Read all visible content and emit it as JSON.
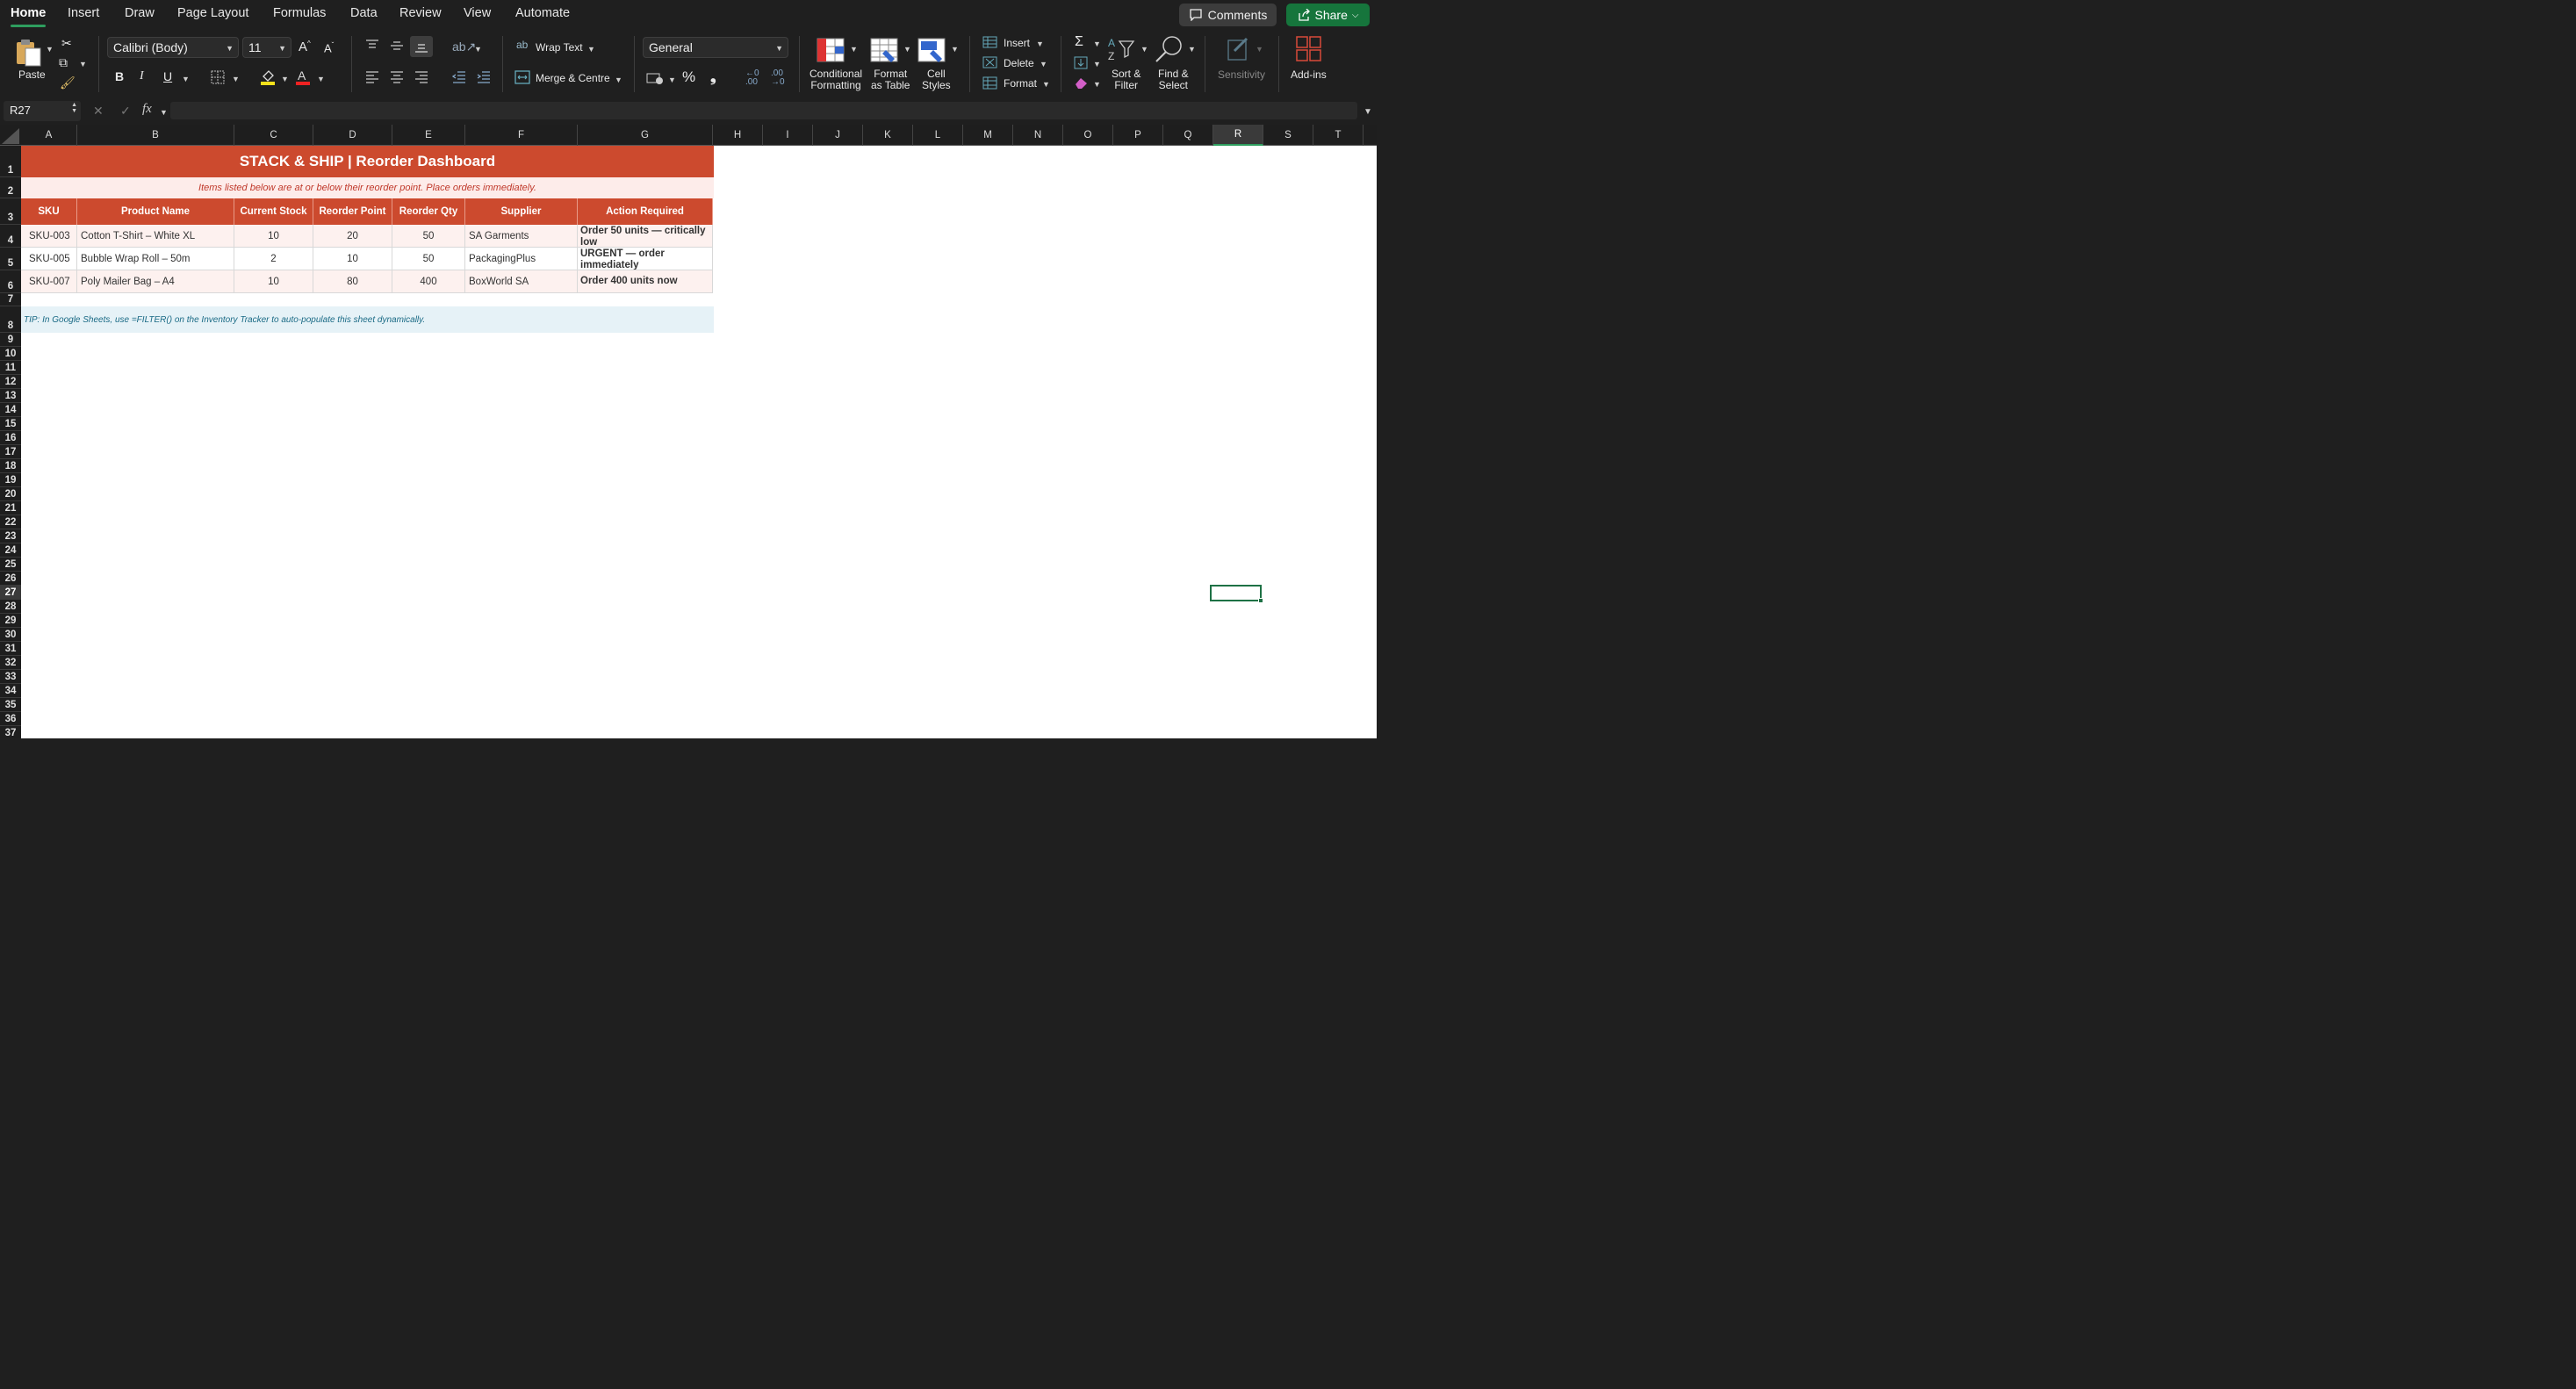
{
  "tabs": [
    "Home",
    "Insert",
    "Draw",
    "Page Layout",
    "Formulas",
    "Data",
    "Review",
    "View",
    "Automate"
  ],
  "header": {
    "comments_label": "Comments",
    "share_label": "Share"
  },
  "ribbon": {
    "paste_label": "Paste",
    "font_name": "Calibri (Body)",
    "font_size": "11",
    "bold": "B",
    "italic": "I",
    "underline": "U",
    "wrap_text_label": "Wrap Text",
    "merge_label": "Merge & Centre",
    "number_format": "General",
    "percent": "%",
    "comma": "❟",
    "conditional_formatting_label": [
      "Conditional",
      "Formatting"
    ],
    "format_as_table_label": [
      "Format",
      "as Table"
    ],
    "cell_styles_label": [
      "Cell",
      "Styles"
    ],
    "insert_label": "Insert",
    "delete_label": "Delete",
    "format_label": "Format",
    "sort_filter_label": [
      "Sort &",
      "Filter"
    ],
    "find_select_label": [
      "Find &",
      "Select"
    ],
    "sensitivity_label": "Sensitivity",
    "addins_label": "Add-ins"
  },
  "formula_bar": {
    "name_box": "R27",
    "formula": ""
  },
  "columns": [
    "A",
    "B",
    "C",
    "D",
    "E",
    "F",
    "G",
    "H",
    "I",
    "J",
    "K",
    "L",
    "M",
    "N",
    "O",
    "P",
    "Q",
    "R",
    "S",
    "T"
  ],
  "selected_column": "R",
  "selected_row": 27,
  "sheet": {
    "title": "STACK & SHIP  |  Reorder Dashboard",
    "subtitle": "Items listed below are at or below their reorder point. Place orders immediately.",
    "headers": [
      "SKU",
      "Product Name",
      "Current Stock",
      "Reorder Point",
      "Reorder Qty",
      "Supplier",
      "Action Required"
    ],
    "rows": [
      [
        "SKU-003",
        "Cotton T-Shirt – White XL",
        "10",
        "20",
        "50",
        "SA Garments",
        "Order 50 units — critically low"
      ],
      [
        "SKU-005",
        "Bubble Wrap Roll – 50m",
        "2",
        "10",
        "50",
        "PackagingPlus",
        "URGENT — order immediately"
      ],
      [
        "SKU-007",
        "Poly Mailer Bag – A4",
        "10",
        "80",
        "400",
        "BoxWorld SA",
        "Order 400 units now"
      ]
    ],
    "tip": "TIP: In Google Sheets, use =FILTER() on the Inventory Tracker to auto-populate this sheet dynamically."
  },
  "colors": {
    "header_red": "#cc4a2e",
    "subtitle_bg": "#fdecea",
    "tip_bg": "#e6f2f7",
    "accent_green": "#16753c"
  }
}
